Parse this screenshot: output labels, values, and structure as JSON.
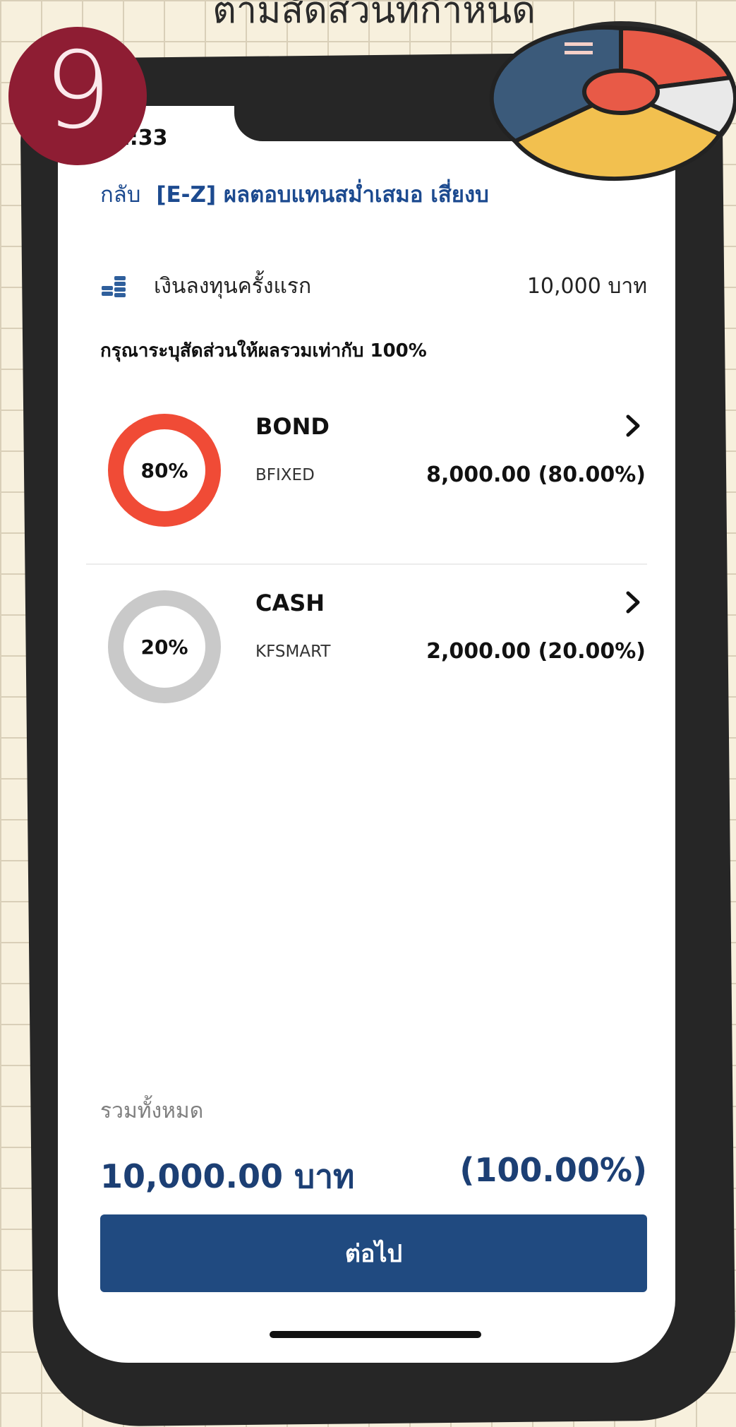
{
  "headline": "ตามสัดส่วนที่กำหนด",
  "step_number": "9",
  "status_time": "11:33",
  "nav": {
    "back_label": "กลับ",
    "title": "[E-Z] ผลตอบแทนสม่ำเสมอ เสี่ยงบ"
  },
  "initial_investment": {
    "icon": "coins-icon",
    "label": "เงินลงทุนครั้งแรก",
    "amount": "10,000 บาท"
  },
  "hint": "กรุณาระบุสัดส่วนให้ผลรวมเท่ากับ 100%",
  "funds": [
    {
      "type": "BOND",
      "code": "BFIXED",
      "percent_label": "80%",
      "value": "8,000.00 (80.00%)",
      "fraction": 0.8,
      "color": "#f04b36"
    },
    {
      "type": "CASH",
      "code": "KFSMART",
      "percent_label": "20%",
      "value": "2,000.00 (20.00%)",
      "fraction": 0.2,
      "color": "#c9c9c9"
    }
  ],
  "total": {
    "label": "รวมทั้งหมด",
    "amount": "10,000.00 บาท",
    "percent": "(100.00%)"
  },
  "next_button": "ต่อไป",
  "colors": {
    "brand_blue": "#204a80",
    "bond_red": "#f04b36",
    "cash_gray": "#c9c9c9",
    "badge_maroon": "#8e1d33"
  }
}
